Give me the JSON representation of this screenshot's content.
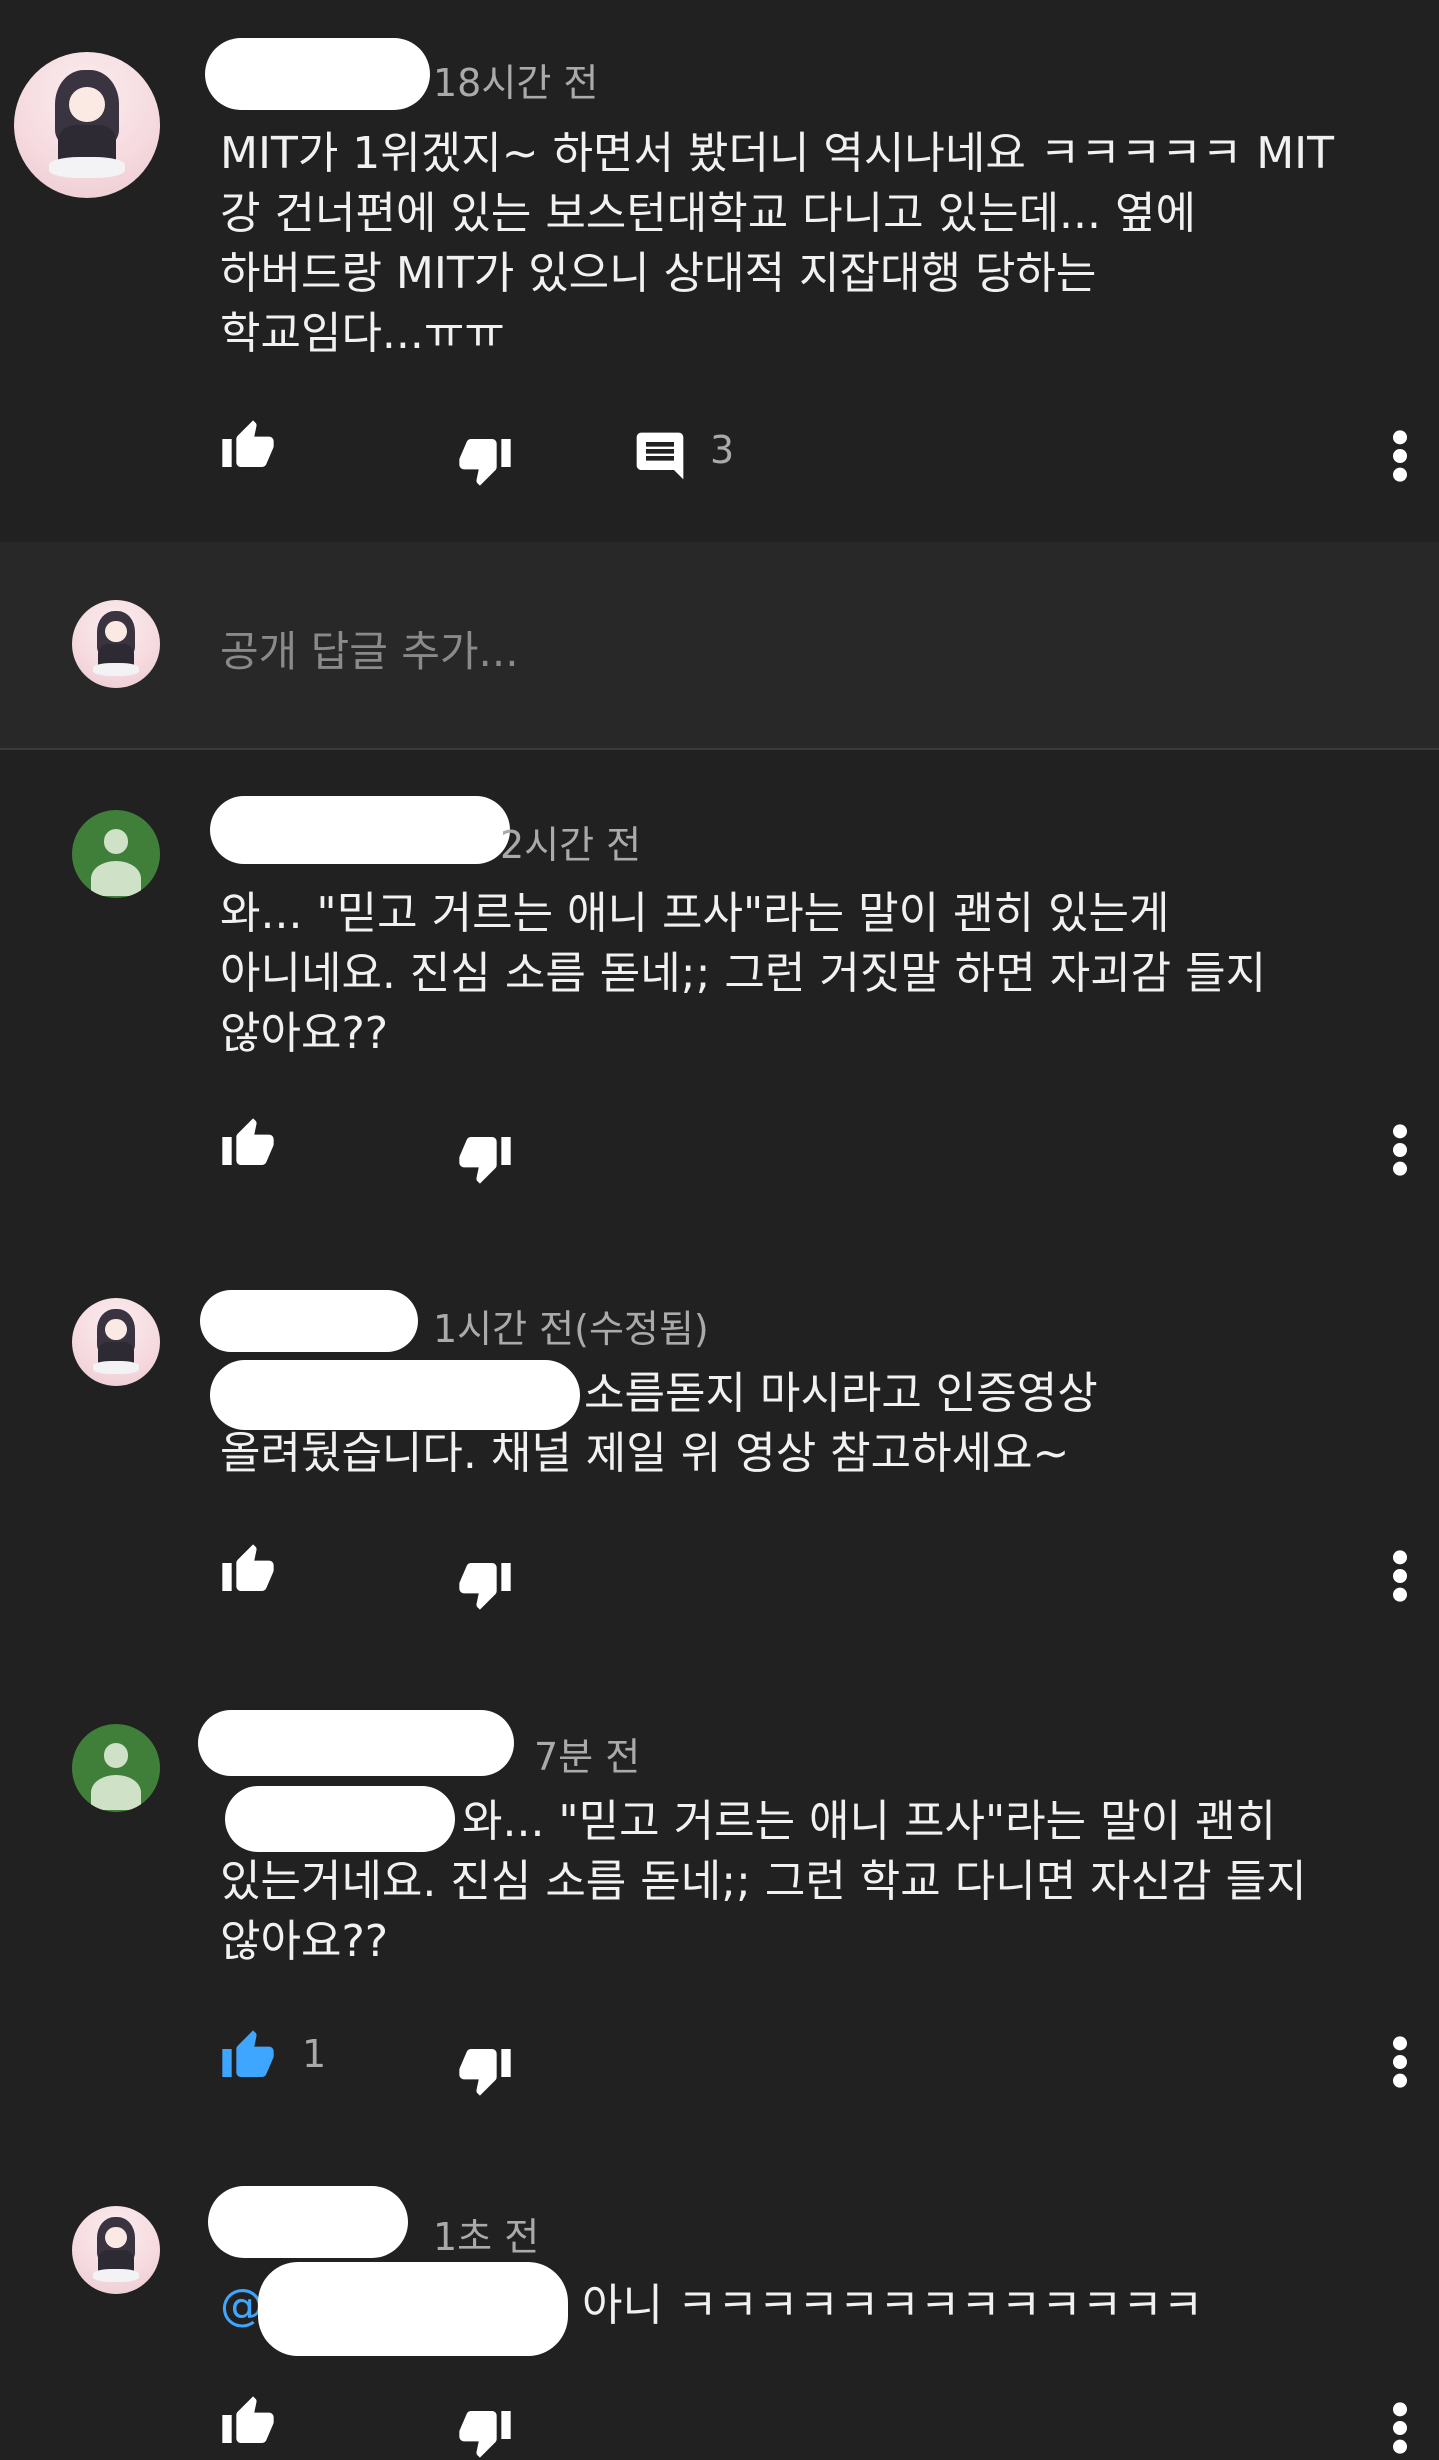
{
  "comments": [
    {
      "time": "18시간 전",
      "lines": [
        "MIT가 1위겠지~ 하면서 봤더니 역시나네요 ㅋㅋㅋㅋㅋ MIT",
        "강 건너편에 있는 보스턴대학교 다니고 있는데... 옆에",
        "하버드랑 MIT가 있으니 상대적 지잡대행 당하는",
        "학교임다...ㅠㅠ"
      ],
      "reply_count": "3"
    },
    {
      "time": "2시간 전",
      "lines": [
        "와... \"믿고 거르는 애니 프사\"라는 말이 괜히 있는게",
        "아니네요. 진심 소름 돋네;; 그런 거짓말 하면 자괴감 들지",
        "않아요??"
      ]
    },
    {
      "time": "1시간 전(수정됨)",
      "lines": [
        "소름돋지 마시라고 인증영상",
        "올려뒀습니다. 채널 제일 위 영상 참고하세요~"
      ]
    },
    {
      "time": "7분 전",
      "lines": [
        "와... \"믿고 거르는 애니 프사\"라는 말이 괜히",
        "있는거네요. 진심 소름 돋네;; 그런 학교 다니면 자신감 들지",
        "않아요??"
      ],
      "like_count": "1"
    },
    {
      "time": "1초 전",
      "mention": "@",
      "lines": [
        "아니 ㅋㅋㅋㅋㅋㅋㅋㅋㅋㅋㅋㅋㅋ"
      ]
    }
  ],
  "reply_input": {
    "placeholder": "공개 답글 추가..."
  },
  "icons": {
    "like": "thumbs-up-icon",
    "dislike": "thumbs-down-icon",
    "reply": "comment-icon",
    "more": "more-vertical-icon"
  },
  "colors": {
    "background": "#212121",
    "accent_like": "#3ea6ff",
    "mention": "#3ea6ff"
  }
}
